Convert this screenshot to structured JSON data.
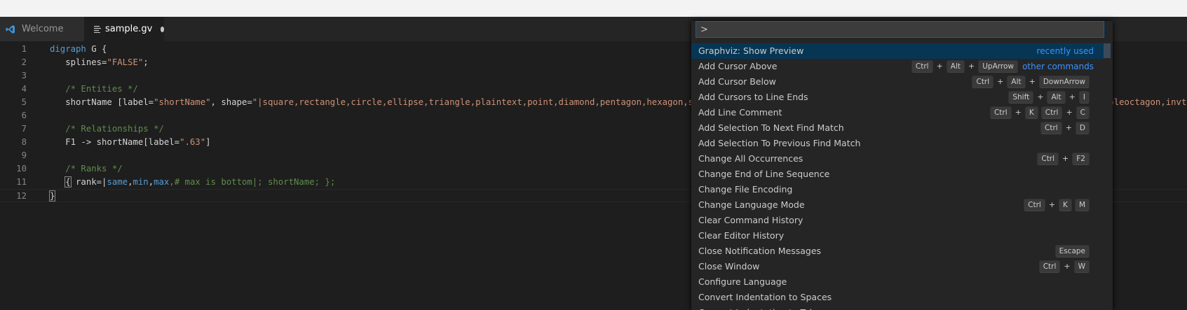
{
  "tabs": [
    {
      "label": "Welcome",
      "icon": "vscode-logo-icon"
    },
    {
      "label": "sample.gv",
      "icon": "file-lines-icon",
      "dirty": true
    }
  ],
  "editor": {
    "lines": [
      {
        "n": "1",
        "tokens": [
          {
            "t": "digraph",
            "c": "kw"
          },
          {
            "t": " G {",
            "c": "plain"
          }
        ]
      },
      {
        "n": "2",
        "tokens": [
          {
            "t": "   splines=",
            "c": "plain"
          },
          {
            "t": "\"FALSE\"",
            "c": "str"
          },
          {
            "t": ";",
            "c": "plain"
          }
        ]
      },
      {
        "n": "3",
        "tokens": []
      },
      {
        "n": "4",
        "tokens": [
          {
            "t": "   /* Entities */",
            "c": "cm"
          }
        ]
      },
      {
        "n": "5",
        "tokens": [
          {
            "t": "   shortName [label=",
            "c": "plain"
          },
          {
            "t": "\"shortName\"",
            "c": "str"
          },
          {
            "t": ", shape=",
            "c": "plain"
          },
          {
            "t": "\"|square,rectangle,circle,ellipse,triangle,plaintext,point,diamond,pentagon,hexagon,septagon,octagon,egg,trapezium,parallelogram,house,doublecircle,doubleoctagon,tripleoctagon,invtriangle,invtrapezium,invhouse",
            "c": "str"
          }
        ]
      },
      {
        "n": "6",
        "tokens": []
      },
      {
        "n": "7",
        "tokens": [
          {
            "t": "   /* Relationships */",
            "c": "cm"
          }
        ]
      },
      {
        "n": "8",
        "tokens": [
          {
            "t": "   F1 -> shortName[label=",
            "c": "plain"
          },
          {
            "t": "\".63\"",
            "c": "str"
          },
          {
            "t": "]",
            "c": "plain"
          }
        ]
      },
      {
        "n": "9",
        "tokens": []
      },
      {
        "n": "10",
        "tokens": [
          {
            "t": "   /* Ranks */",
            "c": "cm"
          }
        ]
      },
      {
        "n": "11",
        "tokens": [
          {
            "t": "   ",
            "c": "plain"
          },
          {
            "t": "{",
            "c": "plain",
            "box": true
          },
          {
            "t": " rank=|",
            "c": "plain"
          },
          {
            "t": "same",
            "c": "kw"
          },
          {
            "t": ",",
            "c": "plain"
          },
          {
            "t": "min",
            "c": "kw"
          },
          {
            "t": ",",
            "c": "plain"
          },
          {
            "t": "max",
            "c": "kw"
          },
          {
            "t": ",# max is bottom|; shortName; };",
            "c": "cm"
          }
        ]
      },
      {
        "n": "12",
        "tokens": [
          {
            "t": "}",
            "c": "plain",
            "box": true
          }
        ],
        "current": true
      }
    ]
  },
  "palette": {
    "input_value": ">",
    "items": [
      {
        "label": "Graphviz: Show Preview",
        "tag": "recently used",
        "selected": true,
        "keys": []
      },
      {
        "label": "Add Cursor Above",
        "tag": "other commands",
        "keys": [
          [
            "Ctrl",
            "Alt",
            "UpArrow"
          ]
        ]
      },
      {
        "label": "Add Cursor Below",
        "keys": [
          [
            "Ctrl",
            "Alt",
            "DownArrow"
          ]
        ]
      },
      {
        "label": "Add Cursors to Line Ends",
        "keys": [
          [
            "Shift",
            "Alt",
            "I"
          ]
        ]
      },
      {
        "label": "Add Line Comment",
        "keys": [
          [
            "Ctrl",
            "K"
          ],
          [
            "Ctrl",
            "C"
          ]
        ]
      },
      {
        "label": "Add Selection To Next Find Match",
        "keys": [
          [
            "Ctrl",
            "D"
          ]
        ]
      },
      {
        "label": "Add Selection To Previous Find Match",
        "keys": []
      },
      {
        "label": "Change All Occurrences",
        "keys": [
          [
            "Ctrl",
            "F2"
          ]
        ]
      },
      {
        "label": "Change End of Line Sequence",
        "keys": []
      },
      {
        "label": "Change File Encoding",
        "keys": []
      },
      {
        "label": "Change Language Mode",
        "keys": [
          [
            "Ctrl",
            "K"
          ],
          [
            "M"
          ]
        ]
      },
      {
        "label": "Clear Command History",
        "keys": []
      },
      {
        "label": "Clear Editor History",
        "keys": []
      },
      {
        "label": "Close Notification Messages",
        "keys": [
          [
            "Escape"
          ]
        ]
      },
      {
        "label": "Close Window",
        "keys": [
          [
            "Ctrl",
            "W"
          ]
        ]
      },
      {
        "label": "Configure Language",
        "keys": []
      },
      {
        "label": "Convert Indentation to Spaces",
        "keys": []
      },
      {
        "label": "Convert Indentation to Tabs",
        "keys": []
      }
    ]
  },
  "colors": {
    "editor_bg": "#1e1e1e",
    "keyword": "#569cd6",
    "string": "#ce9178",
    "comment": "#608b4e",
    "selection": "#073655",
    "link": "#3794ff"
  }
}
